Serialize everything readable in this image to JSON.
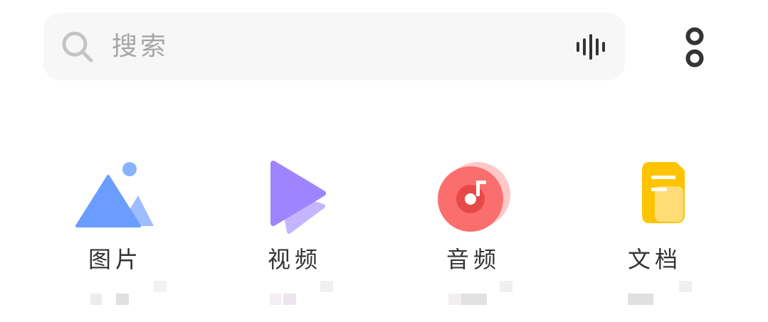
{
  "search": {
    "placeholder": "搜索"
  },
  "colors": {
    "search_bg": "#f7f7f7",
    "text": "#333333",
    "image_blue": "#6a9dff",
    "video_purple": "#9e84ff",
    "audio_red": "#fa6e6e",
    "doc_yellow": "#ffc300"
  },
  "icons": {
    "search": "search-icon",
    "voice": "voice-wave-icon",
    "more": "more-dots-icon"
  },
  "categories": [
    {
      "label": "图片",
      "icon": "image-icon"
    },
    {
      "label": "视频",
      "icon": "video-icon"
    },
    {
      "label": "音频",
      "icon": "audio-icon"
    },
    {
      "label": "文档",
      "icon": "document-icon"
    }
  ]
}
